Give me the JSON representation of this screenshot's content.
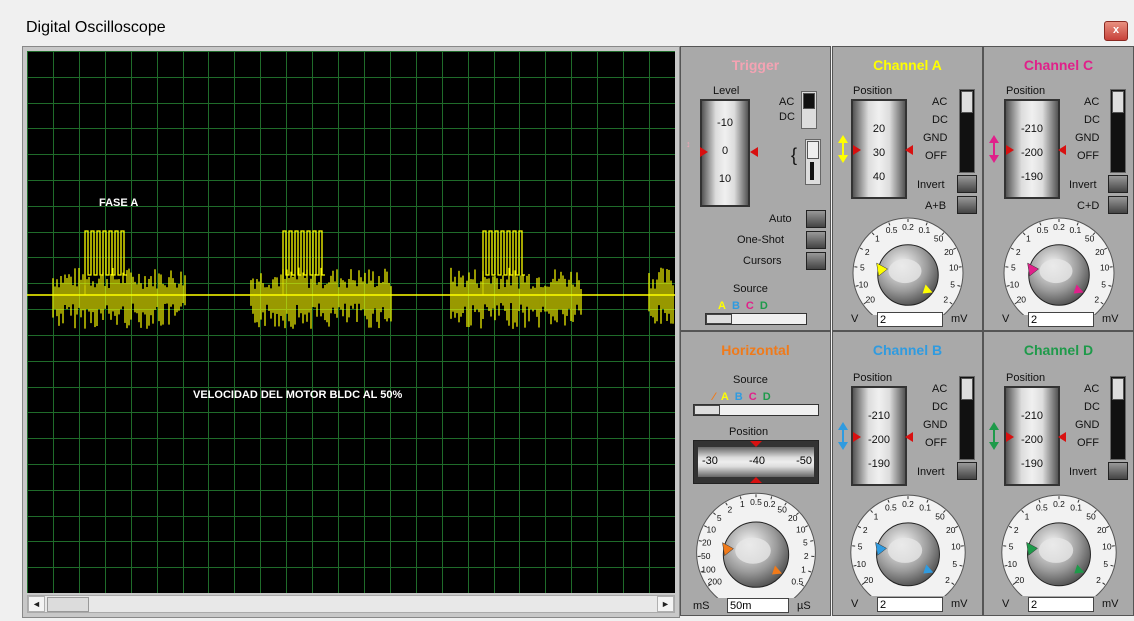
{
  "window": {
    "title": "Digital Oscilloscope",
    "close_symbol": "x"
  },
  "screen": {
    "label_phase": "FASE A",
    "label_motor": "VELOCIDAD DEL MOTOR BLDC AL 50%"
  },
  "scrollbar": {
    "left_arrow": "◄",
    "right_arrow": "►"
  },
  "trigger": {
    "title": "Trigger",
    "level_label": "Level",
    "scale": [
      "-10",
      "0",
      "10"
    ],
    "ac": "AC",
    "dc": "DC",
    "auto": "Auto",
    "oneshot": "One-Shot",
    "cursors": "Cursors",
    "source_label": "Source",
    "sources": [
      "A",
      "B",
      "C",
      "D"
    ]
  },
  "channel_a": {
    "title": "Channel A",
    "position_label": "Position",
    "scale": [
      "20",
      "30",
      "40"
    ],
    "ac": "AC",
    "dc": "DC",
    "gnd": "GND",
    "off": "OFF",
    "invert": "Invert",
    "combine": "A+B",
    "dial_top": [
      "0.5",
      "0.2",
      "0.1"
    ],
    "dial_left": [
      "1",
      "2",
      "5",
      "10",
      "20"
    ],
    "dial_right": [
      "50",
      "20",
      "10",
      "5",
      "2"
    ],
    "unit_left": "V",
    "unit_right": "mV",
    "value": "2"
  },
  "channel_c": {
    "title": "Channel C",
    "position_label": "Position",
    "scale": [
      "-210",
      "-200",
      "-190"
    ],
    "ac": "AC",
    "dc": "DC",
    "gnd": "GND",
    "off": "OFF",
    "invert": "Invert",
    "combine": "C+D",
    "dial_top": [
      "0.5",
      "0.2",
      "0.1"
    ],
    "dial_left": [
      "1",
      "2",
      "5",
      "10",
      "20"
    ],
    "dial_right": [
      "50",
      "20",
      "10",
      "5",
      "2"
    ],
    "unit_left": "V",
    "unit_right": "mV",
    "value": "2"
  },
  "horizontal": {
    "title": "Horizontal",
    "source_label": "Source",
    "sources": [
      "A",
      "B",
      "C",
      "D"
    ],
    "position_label": "Position",
    "scale": [
      "-30",
      "-40",
      "-50"
    ],
    "dial_top": [
      "0.5",
      "0.2"
    ],
    "dial_left": [
      "1",
      "2",
      "5",
      "10",
      "20",
      "50",
      "100",
      "200"
    ],
    "dial_right": [
      "50",
      "20",
      "10",
      "5",
      "2",
      "1",
      "0.5"
    ],
    "unit_left": "mS",
    "unit_right": "µS",
    "value": "50m"
  },
  "channel_b": {
    "title": "Channel B",
    "position_label": "Position",
    "scale": [
      "-210",
      "-200",
      "-190"
    ],
    "ac": "AC",
    "dc": "DC",
    "gnd": "GND",
    "off": "OFF",
    "invert": "Invert",
    "dial_top": [
      "0.5",
      "0.2",
      "0.1"
    ],
    "dial_left": [
      "1",
      "2",
      "5",
      "10",
      "20"
    ],
    "dial_right": [
      "50",
      "20",
      "10",
      "5",
      "2"
    ],
    "unit_left": "V",
    "unit_right": "mV",
    "value": "2"
  },
  "channel_d": {
    "title": "Channel D",
    "position_label": "Position",
    "scale": [
      "-210",
      "-200",
      "-190"
    ],
    "ac": "AC",
    "dc": "DC",
    "gnd": "GND",
    "off": "OFF",
    "invert": "Invert",
    "dial_top": [
      "0.5",
      "0.2",
      "0.1"
    ],
    "dial_left": [
      "1",
      "2",
      "5",
      "10",
      "20"
    ],
    "dial_right": [
      "50",
      "20",
      "10",
      "5",
      "2"
    ],
    "unit_left": "V",
    "unit_right": "mV",
    "value": "2"
  },
  "colors": {
    "trace": "#ffff00",
    "grid": "#1f6b2a",
    "screen_bg": "#000000",
    "channel_a": "#ffff00",
    "channel_b": "#2f9be0",
    "channel_c": "#e0208a",
    "channel_d": "#1e9a4a",
    "trigger_title": "#f4a3b3",
    "horizontal_title": "#f07a1a"
  }
}
